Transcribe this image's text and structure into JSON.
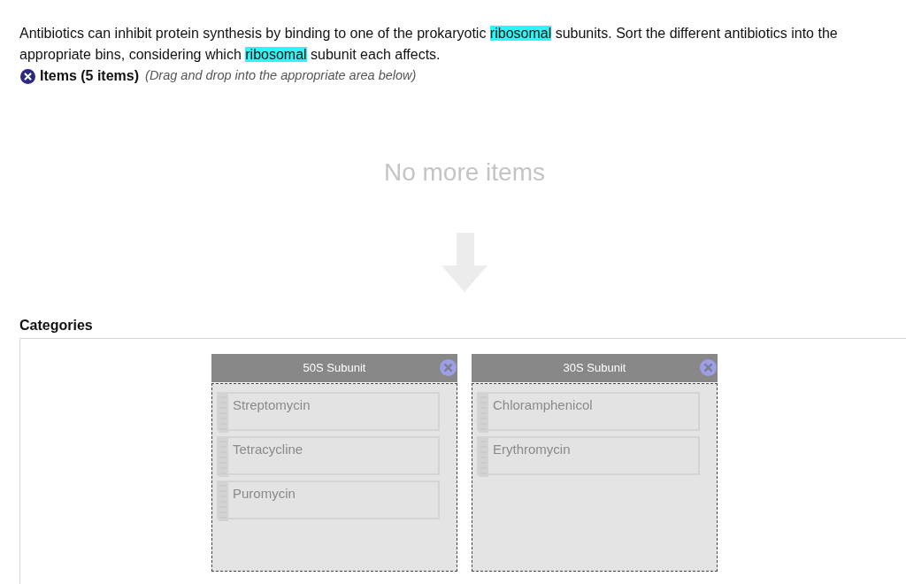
{
  "instructions": {
    "segments": [
      {
        "text": "Antibiotics can inhibit protein synthesis by binding to one of the prokaryotic ",
        "highlighted": false
      },
      {
        "text": "ribosomal",
        "highlighted": true
      },
      {
        "text": " subunits. Sort the different antibiotics into the appropriate bins, considering which ",
        "highlighted": false
      },
      {
        "text": "ribosomal",
        "highlighted": true
      },
      {
        "text": " subunit each affects.",
        "highlighted": false
      }
    ]
  },
  "items_section": {
    "title": "Items (5 items)",
    "hint": "(Drag and drop into the appropriate area below)",
    "empty_message": "No more items"
  },
  "categories": {
    "title": "Categories",
    "bins": [
      {
        "label": "50S Subunit",
        "items": [
          "Streptomycin",
          "Tetracycline",
          "Puromycin"
        ]
      },
      {
        "label": "30S Subunit",
        "items": [
          "Chloramphenicol",
          "Erythromycin"
        ]
      }
    ]
  }
}
